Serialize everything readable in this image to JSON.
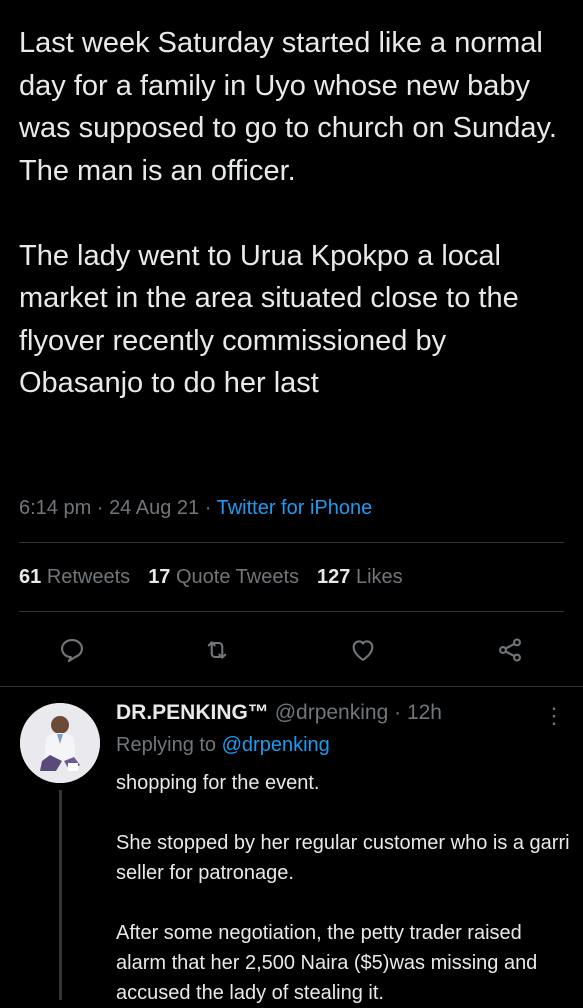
{
  "tweet": {
    "text": "Last week Saturday started like a normal day for a family in Uyo whose new baby was supposed to go to church on Sunday. The man is an officer.\n\nThe lady went to Urua Kpokpo a local market in the area situated close to the flyover recently commissioned by Obasanjo to do her last",
    "time": "6:14 pm",
    "date": "24 Aug 21",
    "separator": "·",
    "source": "Twitter for iPhone",
    "stats": {
      "retweets_count": "61",
      "retweets_label": "Retweets",
      "quotes_count": "17",
      "quotes_label": "Quote Tweets",
      "likes_count": "127",
      "likes_label": "Likes"
    }
  },
  "icons": {
    "reply": "reply-icon",
    "retweet": "retweet-icon",
    "like": "heart-icon",
    "share": "share-icon",
    "more": "more-vertical-icon"
  },
  "colors": {
    "background": "#000000",
    "text": "#e7e9ea",
    "muted": "#71767b",
    "accent": "#1d9bf0",
    "divider": "#2f3336"
  },
  "reply": {
    "name": "DR.PENKING™",
    "handle": "@drpenking",
    "time": "12h",
    "more_glyph": "⋮",
    "replying_prefix": "Replying to",
    "replying_to": "@drpenking",
    "text": "shopping for the event.\n\nShe stopped by her regular customer who is a garri seller for patronage.\n\nAfter some negotiation, the petty trader raised alarm that her 2,500 Naira ($5)was missing and accused the lady of stealing it."
  }
}
